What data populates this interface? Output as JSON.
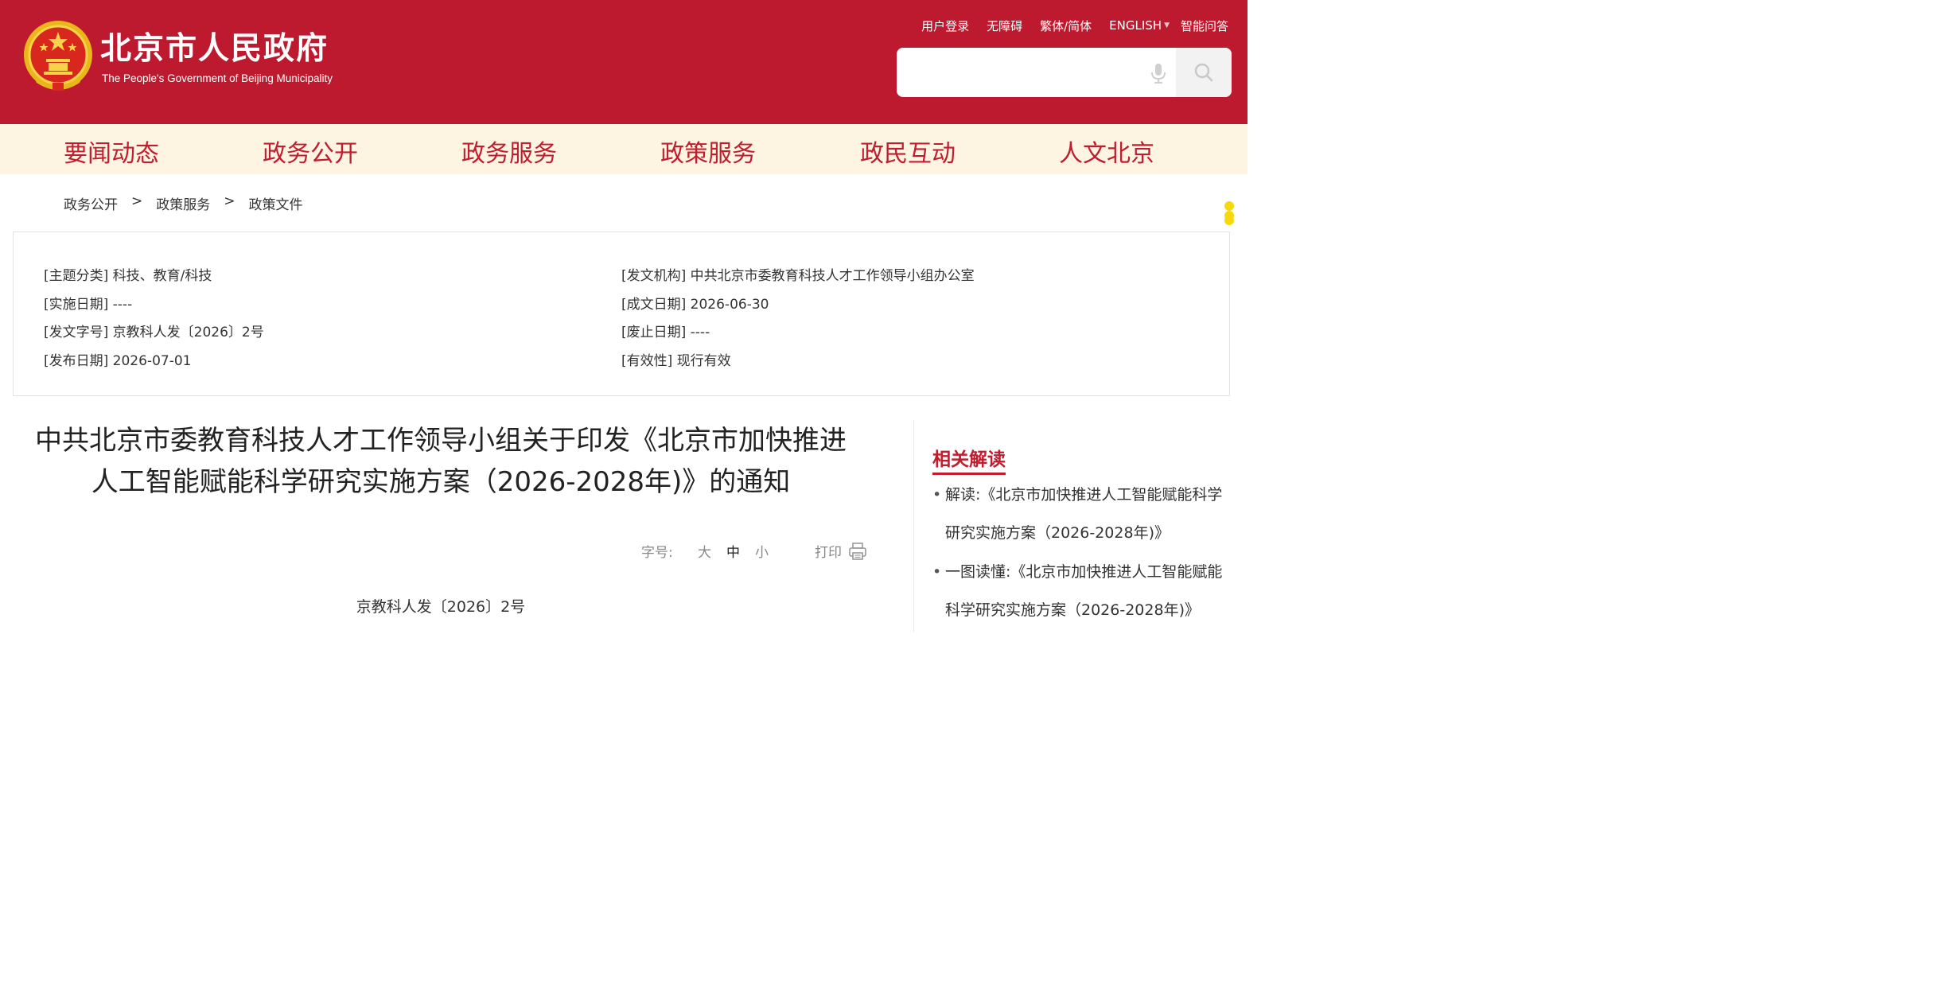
{
  "header": {
    "title": "北京市人民政府",
    "subtitle": "The People's Government of Beijing Municipality",
    "links": {
      "login": "用户登录",
      "accessibility": "无障碍",
      "traditional_simplified": "繁体/简体",
      "english": "ENGLISH",
      "smart_qa": "智能问答"
    },
    "search": {
      "placeholder": ""
    },
    "colors": {
      "header_bg": "#be1a2f",
      "nav_bg": "#fdf4e2",
      "accent": "#c01d2e"
    }
  },
  "nav": {
    "items": [
      "要闻动态",
      "政务公开",
      "政务服务",
      "政策服务",
      "政民互动",
      "人文北京"
    ]
  },
  "breadcrumb": {
    "items": [
      "政务公开",
      "政策服务",
      "政策文件"
    ],
    "separator": ">"
  },
  "info": {
    "topic": "[主题分类] 科技、教育/科技",
    "implement_date": "[实施日期] ----",
    "doc_number": "[发文字号] 京教科人发〔2026〕2号",
    "publish_date": "[发布日期] 2026-07-01",
    "issuer": "[发文机构] 中共北京市委教育科技人才工作领导小组办公室",
    "written_date": "[成文日期] 2026-06-30",
    "repeal_date": "[废止日期] ----",
    "validity": "[有效性] 现行有效"
  },
  "article": {
    "title_line1": "中共北京市委教育科技人才工作领导小组关于印发《北京市加快推进",
    "title_line2": "人工智能赋能科学研究实施方案（2026-2028年)》的通知",
    "font_size_label": "字号:",
    "font_sizes": [
      "大",
      "中",
      "小"
    ],
    "print_label": "打印",
    "doc_number": "京教科人发〔2026〕2号"
  },
  "related": {
    "title": "相关解读",
    "items": [
      {
        "bullet": "•",
        "text": "解读:《北京市加快推进人工智能赋能科学研究实施方案（2026-2028年)》"
      },
      {
        "bullet": "•",
        "text": "一图读懂:《北京市加快推进人工智能赋能科学研究实施方案（2026-2028年)》"
      }
    ]
  }
}
